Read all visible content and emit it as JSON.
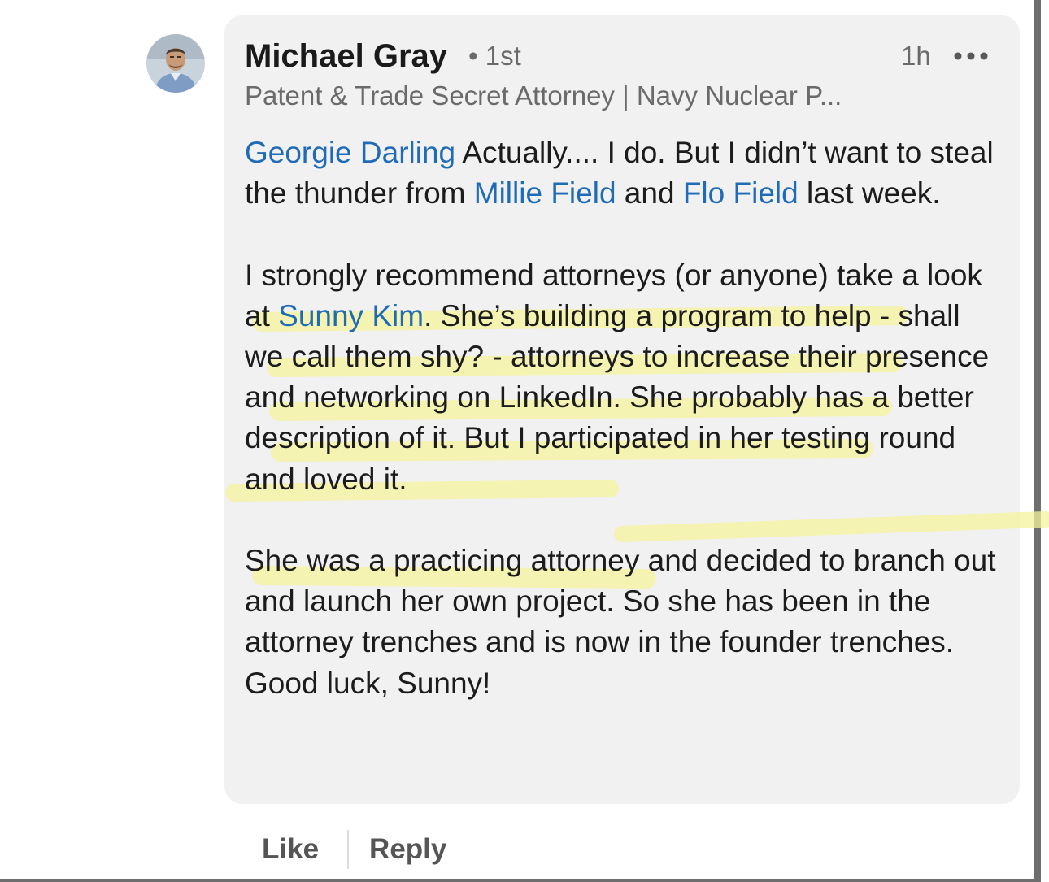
{
  "comment": {
    "author": {
      "name": "Michael Gray",
      "degree": "• 1st",
      "headline": "Patent & Trade Secret Attorney | Navy Nuclear P..."
    },
    "timestamp": "1h",
    "more_icon": "more-horizontal-icon",
    "paragraphs": [
      {
        "segments": [
          {
            "text": "Georgie Darling",
            "mention": true
          },
          {
            "text": " Actually....  I do.  But I didn’t want to steal the thunder from ",
            "mention": false
          },
          {
            "text": "Millie Field",
            "mention": true
          },
          {
            "text": " and ",
            "mention": false
          },
          {
            "text": "Flo Field",
            "mention": true
          },
          {
            "text": " last week.",
            "mention": false
          }
        ]
      },
      {
        "segments": [
          {
            "text": "I strongly recommend attorneys (or anyone) take a look at ",
            "mention": false
          },
          {
            "text": "Sunny Kim",
            "mention": true
          },
          {
            "text": ".  She’s building a program to help - shall we call them shy? - attorneys to increase their presence and networking on LinkedIn.  She probably has a better description of it.  But I participated in her testing round and loved it.",
            "mention": false
          }
        ]
      },
      {
        "segments": [
          {
            "text": "She was a practicing attorney and decided to branch out and launch her own project.  So she has been in the attorney trenches and is now in the founder trenches.  Good luck, Sunny!",
            "mention": false
          }
        ]
      }
    ]
  },
  "actions": {
    "like_label": "Like",
    "reply_label": "Reply"
  },
  "colors": {
    "mention": "#1f6bb8",
    "bubble_background": "#f1f1f1",
    "highlighter": "#f6f39c"
  }
}
